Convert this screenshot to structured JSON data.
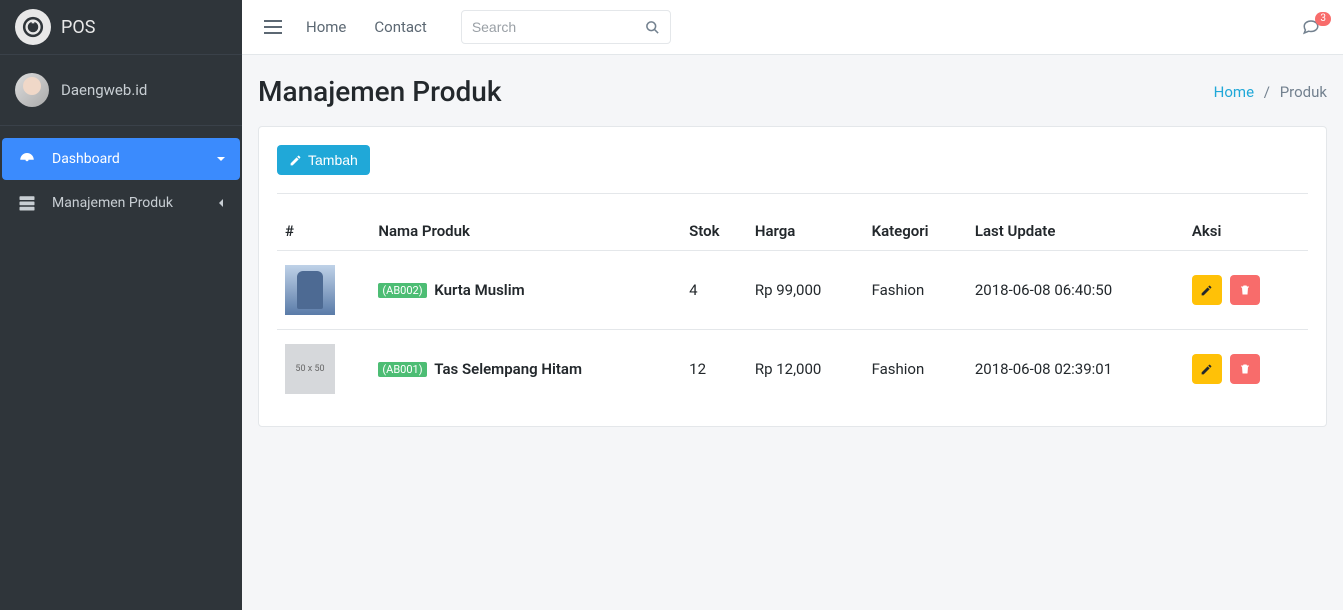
{
  "brand": {
    "text": "POS"
  },
  "user": {
    "name": "Daengweb.id"
  },
  "sidebar": {
    "items": [
      {
        "label": "Dashboard",
        "icon": "dashboard-icon",
        "active": true
      },
      {
        "label": "Manajemen Produk",
        "icon": "server-icon",
        "active": false
      }
    ]
  },
  "topbar": {
    "links": {
      "home": "Home",
      "contact": "Contact"
    },
    "search_placeholder": "Search",
    "notification_count": "3"
  },
  "page": {
    "title": "Manajemen Produk",
    "breadcrumb": {
      "home": "Home",
      "current": "Produk"
    },
    "add_button": "Tambah"
  },
  "table": {
    "headers": {
      "num": "#",
      "name": "Nama Produk",
      "stock": "Stok",
      "price": "Harga",
      "category": "Kategori",
      "updated": "Last Update",
      "action": "Aksi"
    },
    "rows": [
      {
        "code": "(AB002)",
        "name": "Kurta Muslim",
        "stock": "4",
        "price": "Rp 99,000",
        "category": "Fashion",
        "updated": "2018-06-08 06:40:50",
        "thumb": "img1"
      },
      {
        "code": "(AB001)",
        "name": "Tas Selempang Hitam",
        "stock": "12",
        "price": "Rp 12,000",
        "category": "Fashion",
        "updated": "2018-06-08 02:39:01",
        "thumb": "placeholder",
        "thumb_text": "50 x 50"
      }
    ]
  }
}
